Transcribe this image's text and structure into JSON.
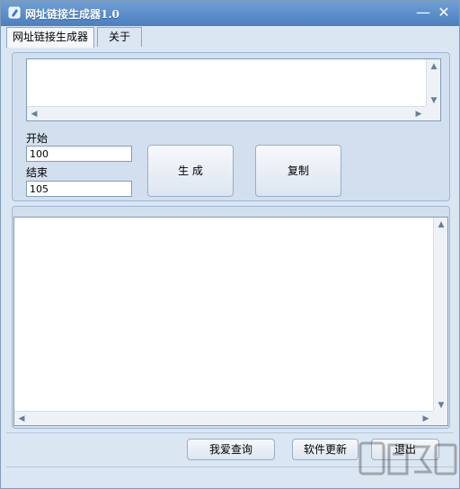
{
  "window": {
    "title": "网址链接生成器1.0",
    "minimize_glyph": "—",
    "close_glyph": "✕"
  },
  "tabs": [
    {
      "label": "网址链接生成器",
      "active": true
    },
    {
      "label": "关于",
      "active": false
    }
  ],
  "form": {
    "start_label": "开始",
    "start_value": "100",
    "end_label": "结束",
    "end_value": "105"
  },
  "buttons": {
    "generate": "生 成",
    "copy": "复制",
    "query": "我爱查询",
    "update": "软件更新",
    "exit": "退出"
  },
  "scroll_glyphs": {
    "up": "▲",
    "down": "▼",
    "left": "◀",
    "right": "▶"
  },
  "icons": {
    "app": "pencil-icon",
    "watermark": "watermark-logo"
  },
  "colors": {
    "titlebar": "#4b7fbf",
    "window_bg": "#dbe6f3",
    "panel_bg": "#d2dfee"
  }
}
